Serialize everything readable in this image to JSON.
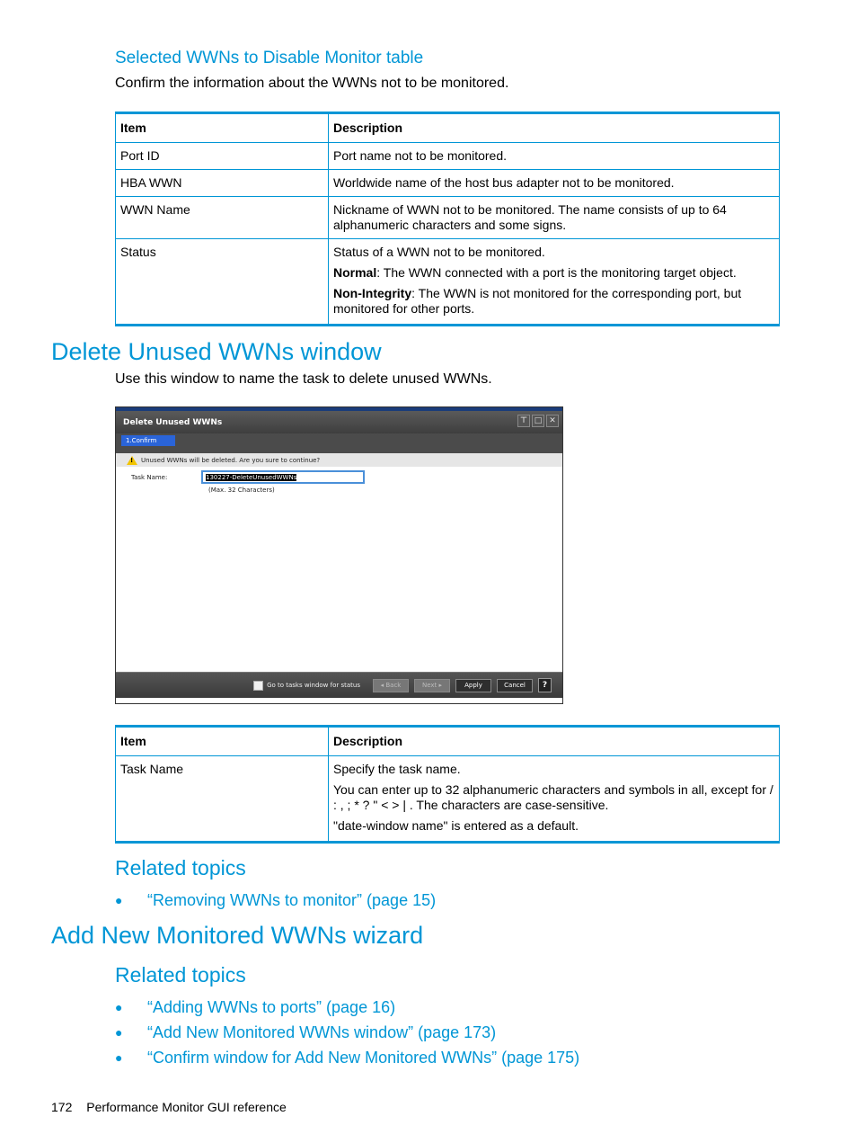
{
  "section1": {
    "heading": "Selected WWNs to Disable Monitor table",
    "intro": "Confirm the information about the WWNs not to be monitored.",
    "table": {
      "headers": [
        "Item",
        "Description"
      ],
      "rows": [
        {
          "item": "Port ID",
          "desc": [
            "Port name not to be monitored."
          ]
        },
        {
          "item": "HBA WWN",
          "desc": [
            "Worldwide name of the host bus adapter not to be monitored."
          ]
        },
        {
          "item": "WWN Name",
          "desc": [
            "Nickname of WWN not to be monitored. The name consists of up to 64 alphanumeric characters and some signs."
          ]
        },
        {
          "item": "Status",
          "desc": [
            "Status of a WWN not to be monitored."
          ],
          "normal_term": "Normal",
          "normal_text": ": The WWN connected with a port is the monitoring target object.",
          "nonint_term": "Non-Integrity",
          "nonint_text": ": The WWN is not monitored for the corresponding port, but monitored for other ports."
        }
      ]
    }
  },
  "section2": {
    "heading": "Delete Unused WWNs window",
    "intro": "Use this window to name the task to delete unused WWNs.",
    "window": {
      "title": "Delete Unused WWNs",
      "step": "1.Confirm",
      "message": "Unused WWNs will be deleted. Are you sure to continue?",
      "task_name_label": "Task Name:",
      "task_name_value": "130227-DeleteUnusedWWNs",
      "task_name_hint": "(Max. 32 Characters)",
      "checkbox_label": "Go to tasks window for status",
      "buttons": {
        "back": "◂ Back",
        "next": "Next ▸",
        "apply": "Apply",
        "cancel": "Cancel",
        "help": "?"
      },
      "ctrl_icons": {
        "pin": "⊤",
        "maximize": "□",
        "close": "✕"
      }
    },
    "table": {
      "headers": [
        "Item",
        "Description"
      ],
      "rows": [
        {
          "item": "Task Name",
          "desc": [
            "Specify the task name.",
            "You can enter up to 32 alphanumeric characters and symbols in all, except for / : , ; * ? \" < > | . The characters are case-sensitive.",
            "\"date-window name\" is entered as a default."
          ]
        }
      ]
    },
    "related_heading": "Related topics",
    "related": [
      "“Removing WWNs to monitor” (page 15)"
    ]
  },
  "section3": {
    "heading": "Add New Monitored WWNs wizard",
    "related_heading": "Related topics",
    "related": [
      "“Adding WWNs to ports” (page 16)",
      "“Add New Monitored WWNs window” (page 173)",
      "“Confirm window for Add New Monitored WWNs” (page 175)"
    ]
  },
  "footer": {
    "page_number": "172",
    "title": "Performance Monitor GUI reference"
  },
  "colors": {
    "accent": "#0096d6"
  }
}
